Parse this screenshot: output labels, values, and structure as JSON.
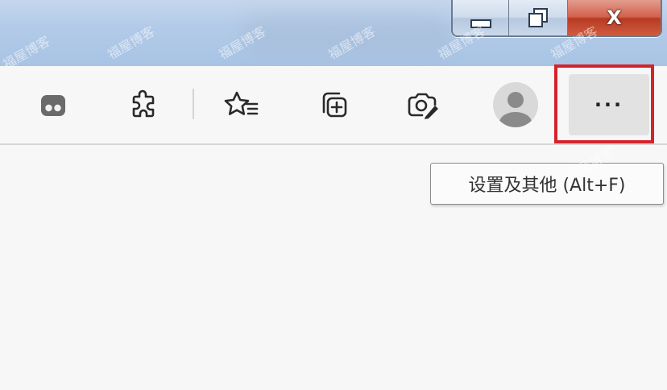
{
  "window_controls": {
    "minimize_icon": "minimize-icon",
    "restore_icon": "restore-icon",
    "close_label": "X"
  },
  "toolbar": {
    "buttons": [
      {
        "name": "extension-badge-icon"
      },
      {
        "name": "extensions-puzzle-icon"
      },
      {
        "name": "favorites-star-icon"
      },
      {
        "name": "collections-icon"
      },
      {
        "name": "screenshot-camera-icon"
      },
      {
        "name": "profile-avatar-icon"
      }
    ],
    "more_label": "···"
  },
  "tooltip": {
    "text": "设置及其他 (Alt+F)"
  },
  "watermark": {
    "text": "福屋博客"
  },
  "colors": {
    "highlight": "#d4232b",
    "titlebar": "#b3cbe8",
    "close_button": "#c6452b"
  }
}
